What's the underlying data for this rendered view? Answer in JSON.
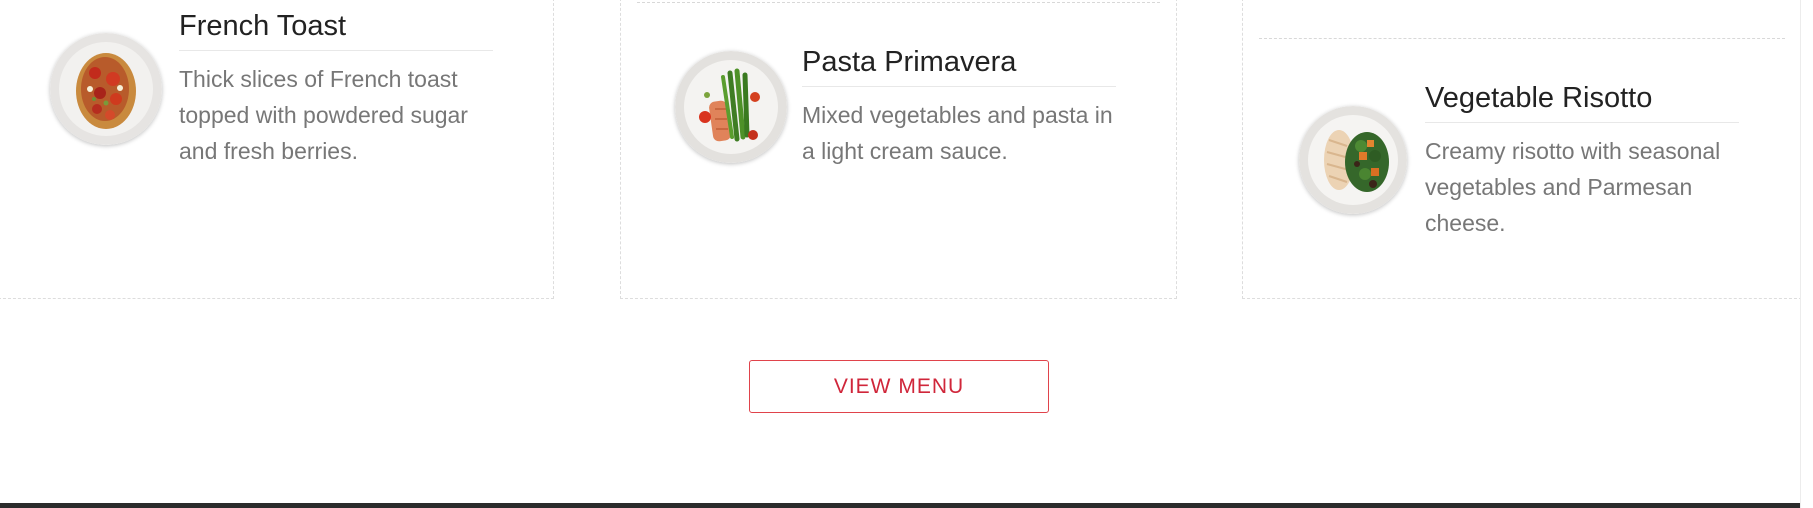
{
  "menu_items": [
    {
      "name": "French Toast",
      "description": "Thick slices of French toast topped with powdered sugar and fresh berries.",
      "image_icon": "french-toast-plate"
    },
    {
      "name": "Pasta Primavera",
      "description": "Mixed vegetables and pasta in a light cream sauce.",
      "image_icon": "salmon-asparagus-plate"
    },
    {
      "name": "Vegetable Risotto",
      "description": "Creamy risotto with seasonal vegetables and Parmesan cheese.",
      "image_icon": "chicken-salad-plate"
    }
  ],
  "cta": {
    "label": "VIEW MENU"
  },
  "colors": {
    "accent": "#d0263a",
    "title": "#222222",
    "body_text": "#777777",
    "footer": "#2b2b2b"
  }
}
